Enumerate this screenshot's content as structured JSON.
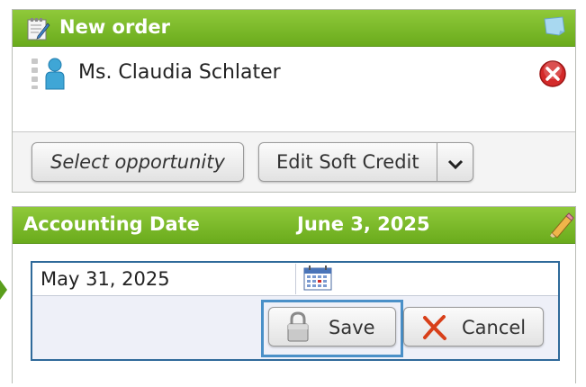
{
  "order": {
    "title": "New order",
    "contact_name": "Ms. Claudia Schlater",
    "select_opportunity_label": "Select opportunity",
    "edit_soft_credit_label": "Edit Soft Credit"
  },
  "accounting": {
    "title": "Accounting Date",
    "date_value": "June 3, 2025",
    "date_input_value": "May 31, 2025",
    "save_label": "Save",
    "cancel_label": "Cancel"
  },
  "colors": {
    "header_green": "#7bbb2a",
    "edit_box_border": "#2f6a9a",
    "save_focus_border": "#4a90c8",
    "remove_red": "#d42a2a"
  },
  "icons": [
    "notepad-icon",
    "note-icon",
    "drag-handle-icon",
    "person-icon",
    "remove-icon",
    "chevron-down-icon",
    "pencil-icon",
    "calendar-icon",
    "lock-icon",
    "cancel-x-icon",
    "expand-arrow-icon"
  ]
}
